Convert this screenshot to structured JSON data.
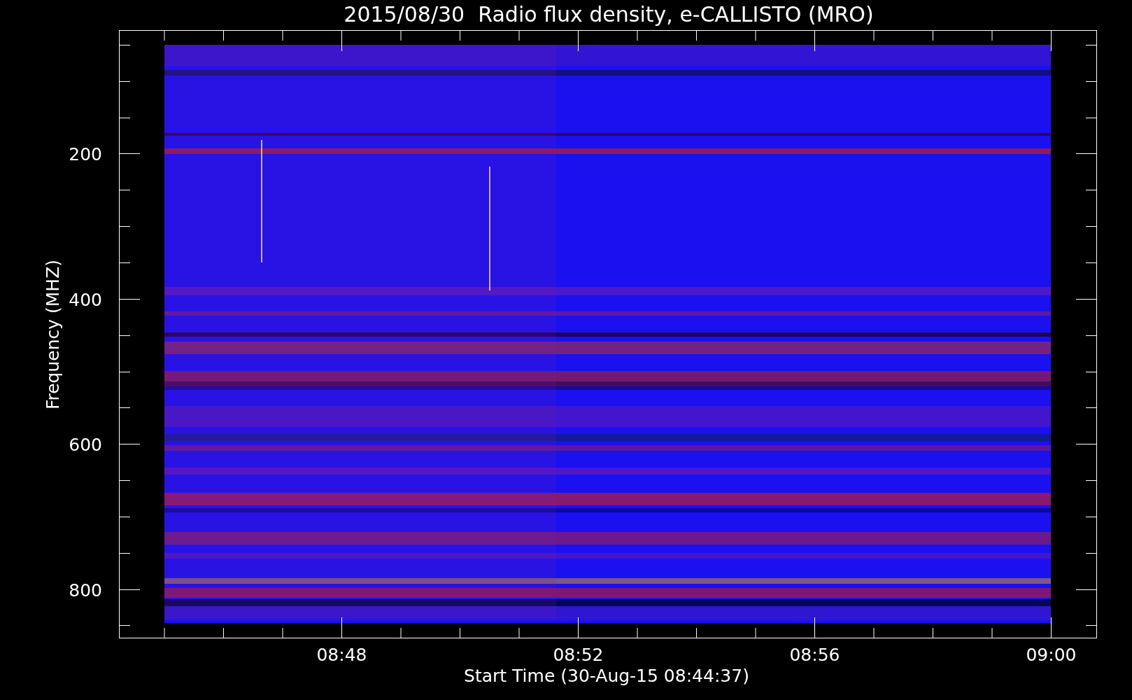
{
  "plot": {
    "title": "2015/08/30  Radio flux density, e-CALLISTO (MRO)",
    "ylabel": "Frequency (MHZ)",
    "xlabel": "Start Time (30-Aug-15 08:44:37)",
    "yticks": [
      "200",
      "400",
      "600",
      "800"
    ],
    "xticks": [
      "08:48",
      "08:52",
      "08:56",
      "09:00"
    ]
  }
}
